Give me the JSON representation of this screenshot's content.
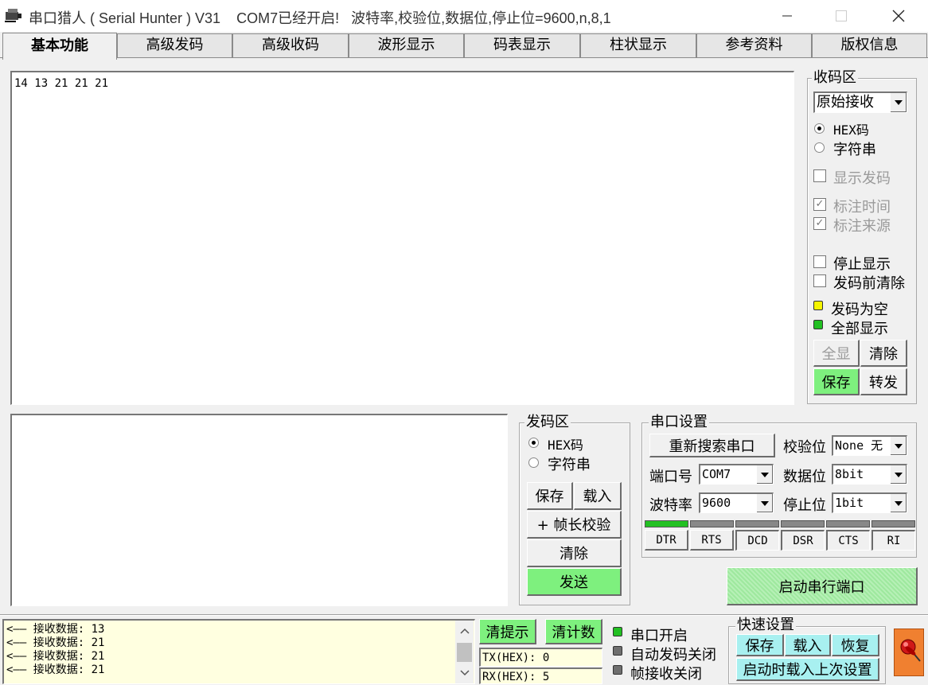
{
  "window": {
    "title": "串口猎人 ( Serial Hunter ) V31    COM7已经开启!   波特率,校验位,数据位,停止位=9600,n,8,1"
  },
  "tabs": [
    "基本功能",
    "高级发码",
    "高级收码",
    "波形显示",
    "码表显示",
    "柱状显示",
    "参考资料",
    "版权信息"
  ],
  "receive_text": "14 13 21 21 21",
  "send_text": "",
  "recv_area": {
    "title": "收码区",
    "mode_select": "原始接收",
    "radio_hex": "HEX码",
    "radio_str": "字符串",
    "chk_show_send": "显示发码",
    "chk_mark_time": "标注时间",
    "chk_mark_source": "标注来源",
    "chk_stop_display": "停止显示",
    "chk_clear_before_send": "发码前清除",
    "led_send_empty": "发码为空",
    "led_show_all": "全部显示",
    "btn_all": "全显",
    "btn_clear": "清除",
    "btn_save": "保存",
    "btn_forward": "转发"
  },
  "send_area": {
    "title": "发码区",
    "radio_hex": "HEX码",
    "radio_str": "字符串",
    "btn_save": "保存",
    "btn_load": "载入",
    "btn_frame_check": "+ 帧长校验",
    "btn_clear": "清除",
    "btn_send": "发送"
  },
  "port_settings": {
    "title": "串口设置",
    "btn_rescan": "重新搜索串口",
    "label_port": "端口号",
    "port_value": "COM7",
    "label_baud": "波特率",
    "baud_value": "9600",
    "label_parity": "校验位",
    "parity_value": "None 无",
    "label_databits": "数据位",
    "databits_value": "8bit",
    "label_stopbits": "停止位",
    "stopbits_value": "1bit",
    "signals": [
      {
        "label": "DTR",
        "on": true
      },
      {
        "label": "RTS",
        "on": false
      },
      {
        "label": "DCD",
        "on": false
      },
      {
        "label": "DSR",
        "on": false
      },
      {
        "label": "CTS",
        "on": false
      },
      {
        "label": "RI",
        "on": false
      }
    ],
    "btn_start": "启动串行端口"
  },
  "status": {
    "log_lines": [
      "<—— 接收数据: 13",
      "<—— 接收数据: 21",
      "<—— 接收数据: 21",
      "<—— 接收数据: 21"
    ],
    "btn_clear_tips": "清提示",
    "btn_clear_count": "清计数",
    "tx": "TX(HEX): 0",
    "rx": "RX(HEX): 5",
    "led_port_open": "串口开启",
    "led_auto_send_off": "自动发码关闭",
    "led_frame_recv_off": "帧接收关闭"
  },
  "quick": {
    "title": "快速设置",
    "btn_save": "保存",
    "btn_load": "载入",
    "btn_restore": "恢复",
    "btn_load_last": "启动时载入上次设置"
  },
  "colors": {
    "green_button": "#7ef07e",
    "led_green": "#22c022",
    "led_yellow": "#f5f500",
    "led_gray": "#6e6e6e",
    "log_background": "#ffffe0"
  }
}
